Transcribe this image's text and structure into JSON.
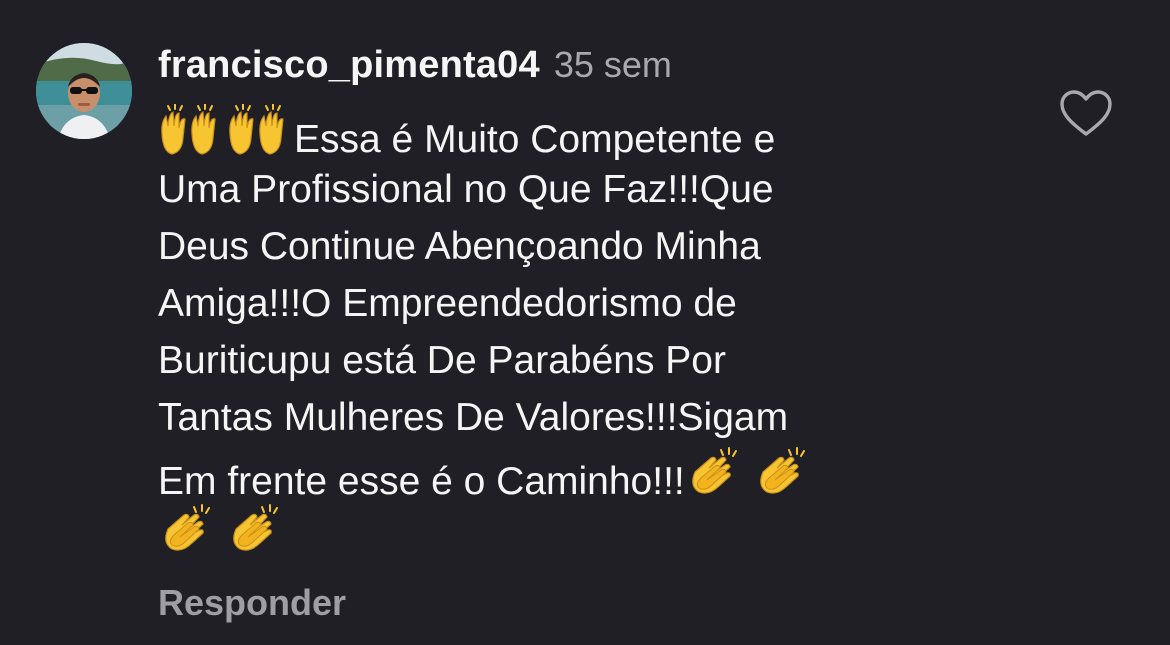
{
  "comment": {
    "username": "francisco_pimenta04",
    "timestamp": "35 sem",
    "lines": [
      "Essa é Muito Competente e",
      "Uma Profissional no Que Faz!!!Que",
      "Deus Continue Abençoando Minha",
      "Amiga!!!O Empreendedorismo de",
      "Buriticupu está De Parabéns Por",
      "Tantas Mulheres De Valores!!!Sigam",
      "Em frente esse é o Caminho!!!"
    ],
    "emojis": {
      "raised_hands": "🙌",
      "clapping_hands": "👏"
    },
    "reply_label": "Responder",
    "like_icon": "heart-outline-icon"
  },
  "colors": {
    "background": "#1f1f25",
    "text": "#f5f5f5",
    "secondary_text": "#a8a8ae",
    "emoji_yellow": "#f7c531"
  }
}
